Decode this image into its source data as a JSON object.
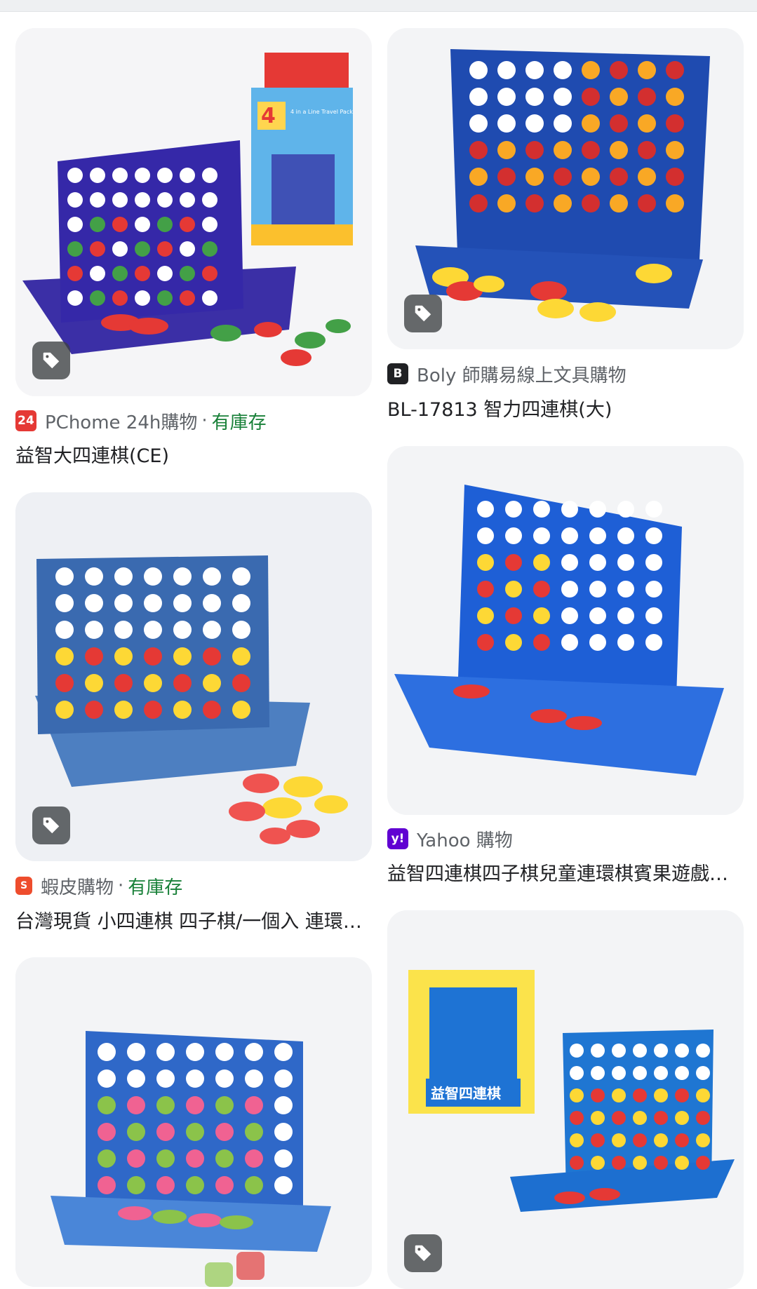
{
  "results": [
    {
      "source": "PChome 24h購物",
      "stock": "有庫存",
      "title": "益智大四連棋(CE)",
      "icon_label": "24",
      "icon_color": "#e53935"
    },
    {
      "source": "Boly 師購易線上文具購物",
      "title": "BL-17813 智力四連棋(大)",
      "icon_label": "B",
      "icon_color": "#202124"
    },
    {
      "source": "蝦皮購物",
      "stock": "有庫存",
      "title": "台灣現貨 小四連棋 四子棋/一個入 連環棋 賓果遊戲",
      "icon_label": "S",
      "icon_color": "#ee4d2d"
    },
    {
      "source": "Yahoo 購物",
      "title": "益智四連棋四子棋兒童連環棋賓果遊戲益智玩具",
      "icon_label": "y!",
      "icon_color": "#6001d2"
    }
  ],
  "dot_separator": "·",
  "product_box_art": {
    "banner": "4 in a Line Travel Pack",
    "name": "益智四連棋"
  },
  "colors": {
    "stock_green": "#188038",
    "meta_gray": "#5f6368",
    "title_black": "#202124"
  }
}
